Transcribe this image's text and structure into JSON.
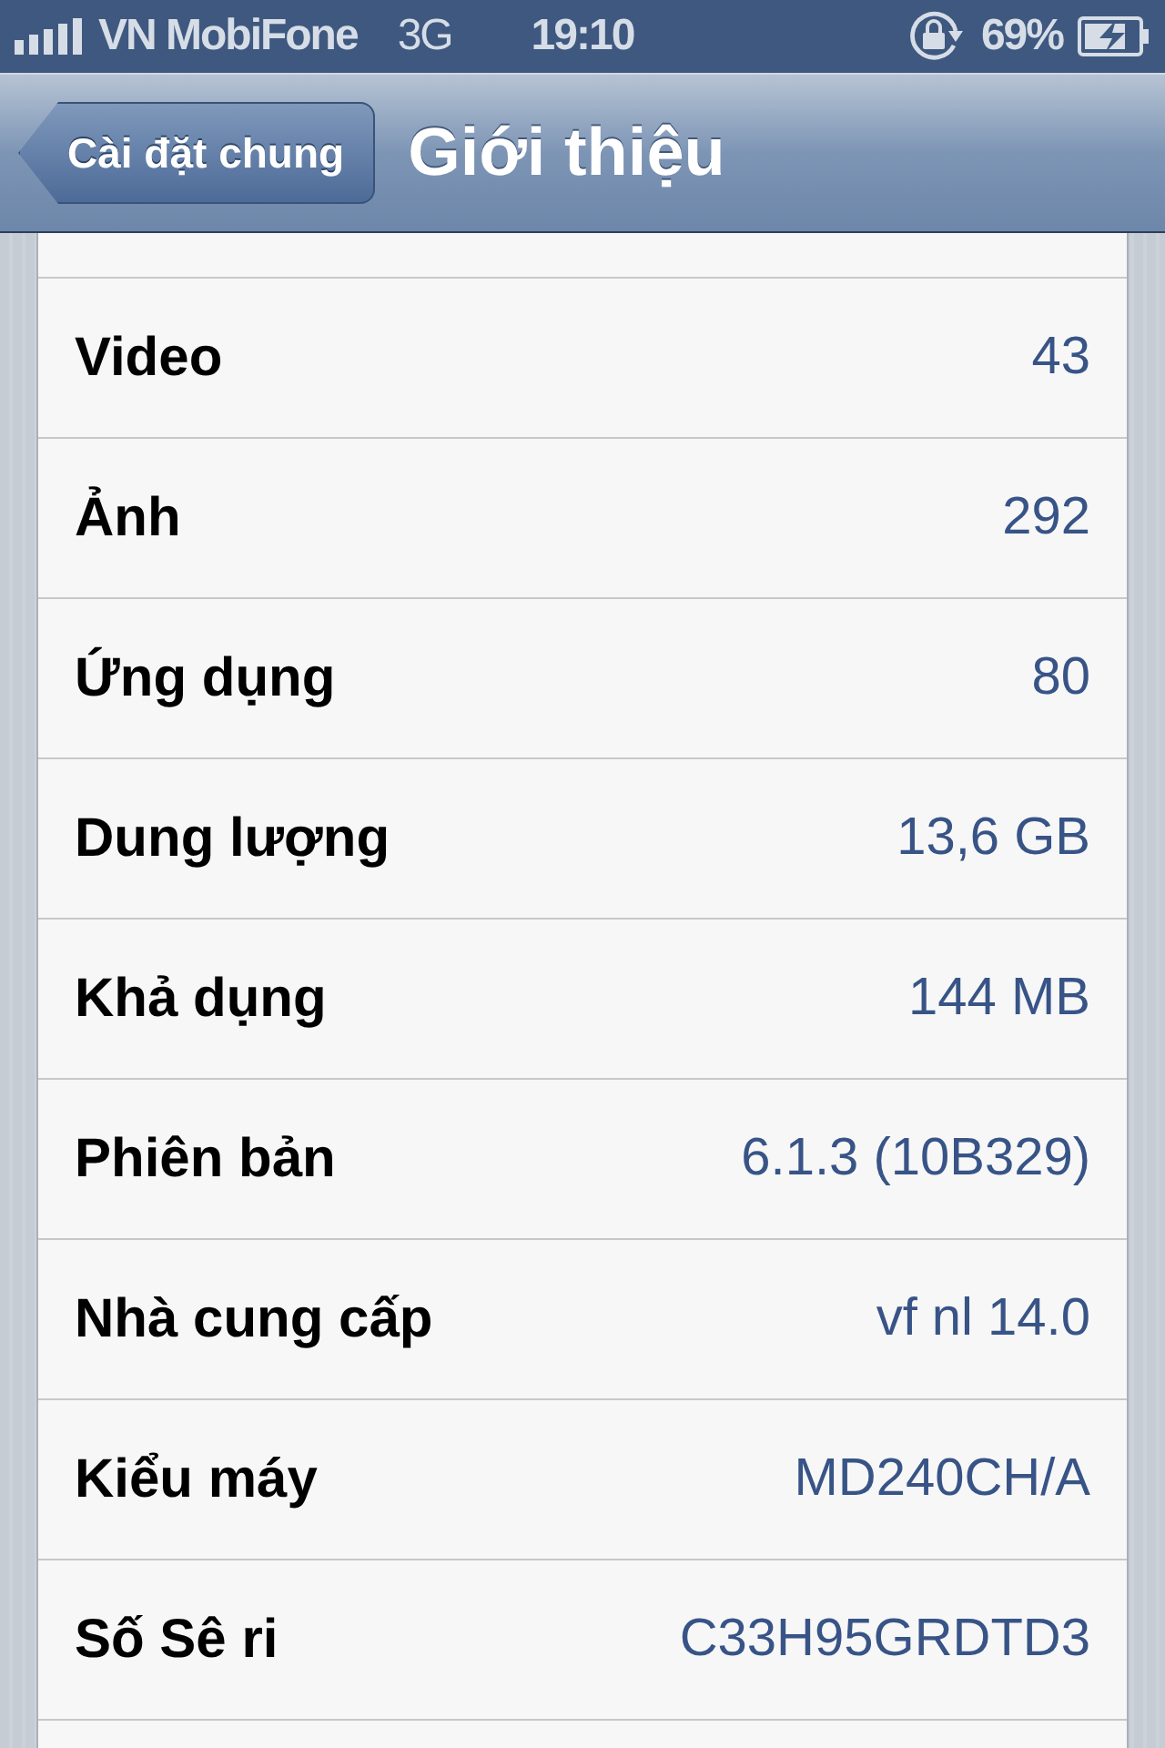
{
  "status_bar": {
    "carrier": "VN MobiFone",
    "network": "3G",
    "time": "19:10",
    "battery": "69%"
  },
  "nav_bar": {
    "back_button": "Cài đặt chung",
    "title": "Giới thiệu"
  },
  "rows": [
    {
      "label": "Video",
      "value": "43"
    },
    {
      "label": "Ảnh",
      "value": "292"
    },
    {
      "label": "Ứng dụng",
      "value": "80"
    },
    {
      "label": "Dung lượng",
      "value": "13,6 GB"
    },
    {
      "label": "Khả dụng",
      "value": "144 MB"
    },
    {
      "label": "Phiên bản",
      "value": "6.1.3 (10B329)"
    },
    {
      "label": "Nhà cung cấp",
      "value": "vf nl 14.0"
    },
    {
      "label": "Kiểu máy",
      "value": "MD240CH/A"
    },
    {
      "label": "Số Sê ri",
      "value": "C33H95GRDTD3"
    }
  ]
}
